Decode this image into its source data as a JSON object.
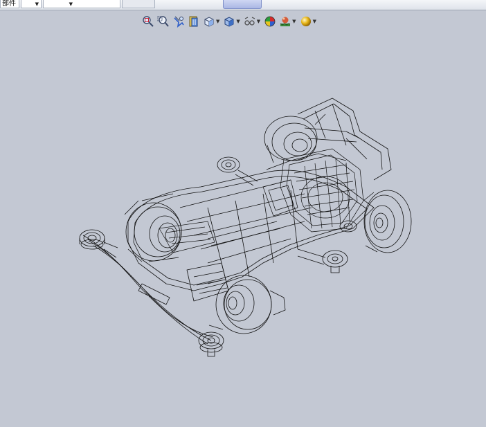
{
  "topbar": {
    "combo1_label": "部件",
    "combo2_label": ""
  },
  "toolbar": {
    "buttons": [
      {
        "icon": "zoom-to-fit-icon"
      },
      {
        "icon": "zoom-to-area-icon"
      },
      {
        "icon": "previous-view-icon"
      },
      {
        "icon": "section-view-icon"
      },
      {
        "icon": "view-orientation-icon",
        "dropdown": true
      },
      {
        "icon": "display-style-icon",
        "dropdown": true
      },
      {
        "icon": "hide-show-items-icon",
        "dropdown": true
      },
      {
        "icon": "edit-appearance-icon"
      },
      {
        "icon": "apply-scene-icon",
        "dropdown": true
      },
      {
        "icon": "view-settings-icon",
        "dropdown": true
      }
    ]
  },
  "viewport": {
    "model": "wireframe-racing-car-model",
    "watermark": "",
    "colors": {
      "background": "#c3c8d3",
      "wire": "#111111"
    }
  }
}
